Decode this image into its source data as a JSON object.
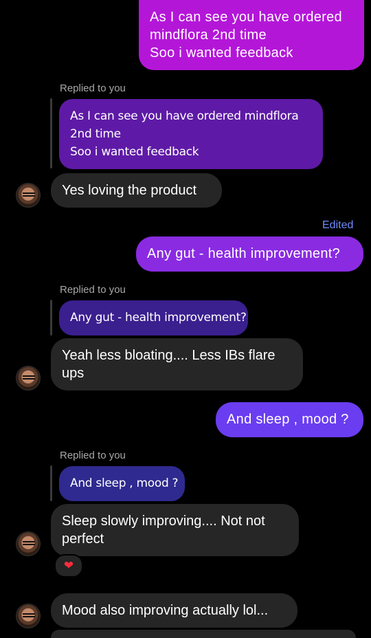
{
  "messages": {
    "out1": {
      "lines": [
        "As I can see you have ordered",
        "mindflora 2nd time",
        "Soo i wanted feedback"
      ],
      "color": "#b416d8"
    },
    "reply1": {
      "label": "Replied to you",
      "lines": [
        "As I can see you have ordered mindflora",
        "2nd time",
        "Soo i wanted feedback"
      ],
      "color": "#5e1aa6"
    },
    "in1": {
      "text": "Yes loving the product"
    },
    "edited_label": "Edited",
    "out2": {
      "text": "Any gut - health improvement?",
      "color": "#8a2be2"
    },
    "reply2": {
      "label": "Replied to you",
      "text": "Any gut - health improvement?",
      "color": "#3a1f8f"
    },
    "in2": {
      "lines": [
        "Yeah less bloating.... Less IBs flare",
        "ups"
      ]
    },
    "out3": {
      "text": "And sleep , mood ?",
      "color": "#6a3df0"
    },
    "reply3": {
      "label": "Replied to you",
      "text": "And sleep , mood ?",
      "color": "#2f2a8f"
    },
    "in3": {
      "lines": [
        "Sleep slowly improving.... Not not",
        "perfect"
      ]
    },
    "in3_reaction": {
      "icon": "heart-icon",
      "glyph": "❤"
    },
    "in4": {
      "text": "Mood also improving actually lol..."
    }
  }
}
